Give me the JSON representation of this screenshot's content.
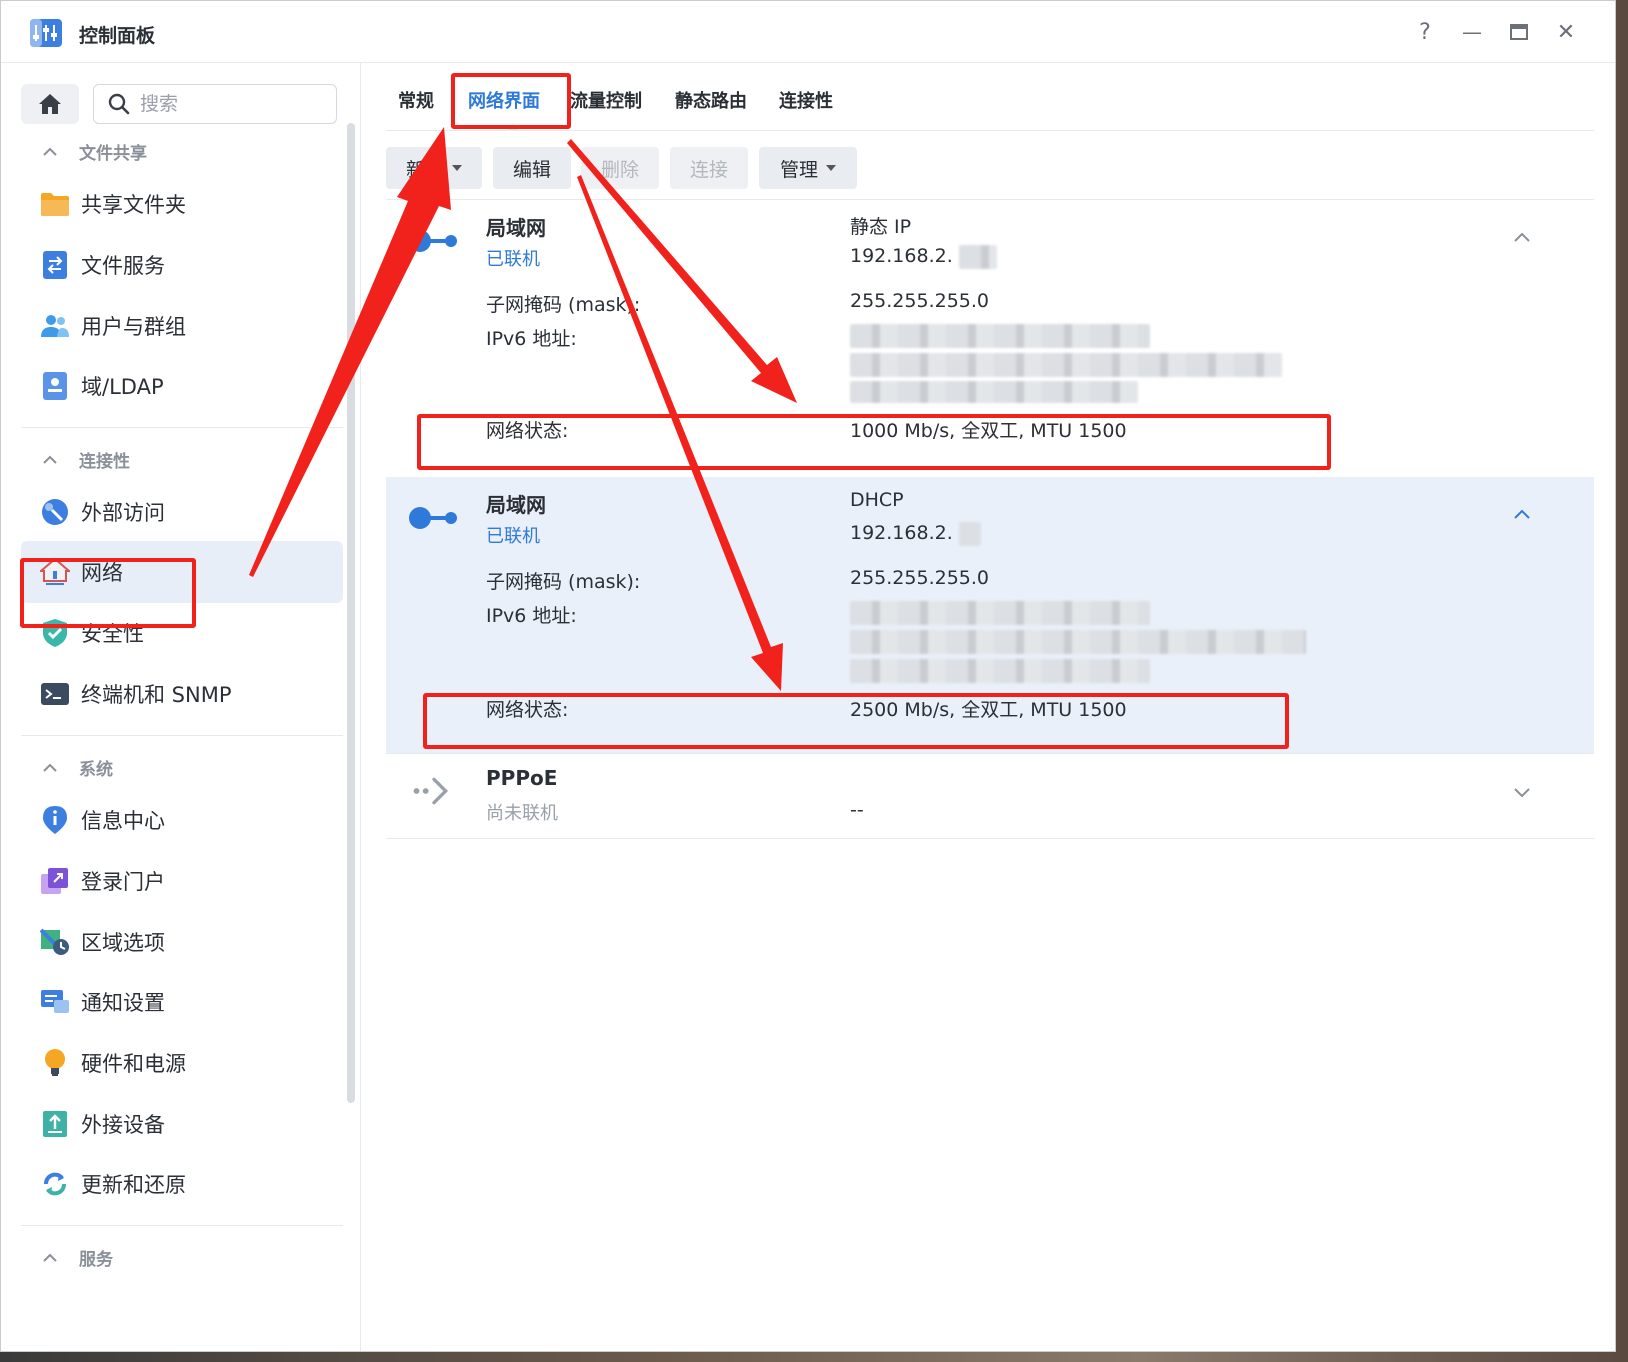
{
  "app": {
    "title": "控制面板"
  },
  "window_controls": {
    "help": "?",
    "minimize": "—",
    "maximize": "▭",
    "close": "✕"
  },
  "sidebar": {
    "search_placeholder": "搜索",
    "sections": [
      {
        "title": "文件共享",
        "items": [
          "共享文件夹",
          "文件服务",
          "用户与群组",
          "域/LDAP"
        ]
      },
      {
        "title": "连接性",
        "items": [
          "外部访问",
          "网络",
          "安全性",
          "终端机和 SNMP"
        ]
      },
      {
        "title": "系统",
        "items": [
          "信息中心",
          "登录门户",
          "区域选项",
          "通知设置",
          "硬件和电源",
          "外接设备",
          "更新和还原"
        ]
      },
      {
        "title": "服务",
        "items": []
      }
    ],
    "active_item": "网络"
  },
  "tabs": [
    "常规",
    "网络界面",
    "流量控制",
    "静态路由",
    "连接性"
  ],
  "active_tab": "网络界面",
  "toolbar": {
    "create": "新增",
    "edit": "编辑",
    "delete": "删除",
    "connect": "连接",
    "manage": "管理"
  },
  "interfaces": [
    {
      "name": "局域网",
      "status": "已联机",
      "mode": "静态 IP",
      "ip": "192.168.2.",
      "mask_label": "子网掩码 (mask):",
      "mask": "255.255.255.0",
      "ipv6_label": "IPv6 地址:",
      "net_status_label": "网络状态:",
      "net_status": "1000 Mb/s, 全双工, MTU 1500"
    },
    {
      "name": "局域网",
      "status": "已联机",
      "mode": "DHCP",
      "ip": "192.168.2.",
      "mask_label": "子网掩码 (mask):",
      "mask": "255.255.255.0",
      "ipv6_label": "IPv6 地址:",
      "net_status_label": "网络状态:",
      "net_status": "2500 Mb/s, 全双工, MTU 1500"
    },
    {
      "name": "PPPoE",
      "status": "尚未联机",
      "value": "--"
    }
  ],
  "colors": {
    "accent": "#2f7ad9",
    "annotation": "#f0221b",
    "highlight_row": "#eaf0fa"
  }
}
